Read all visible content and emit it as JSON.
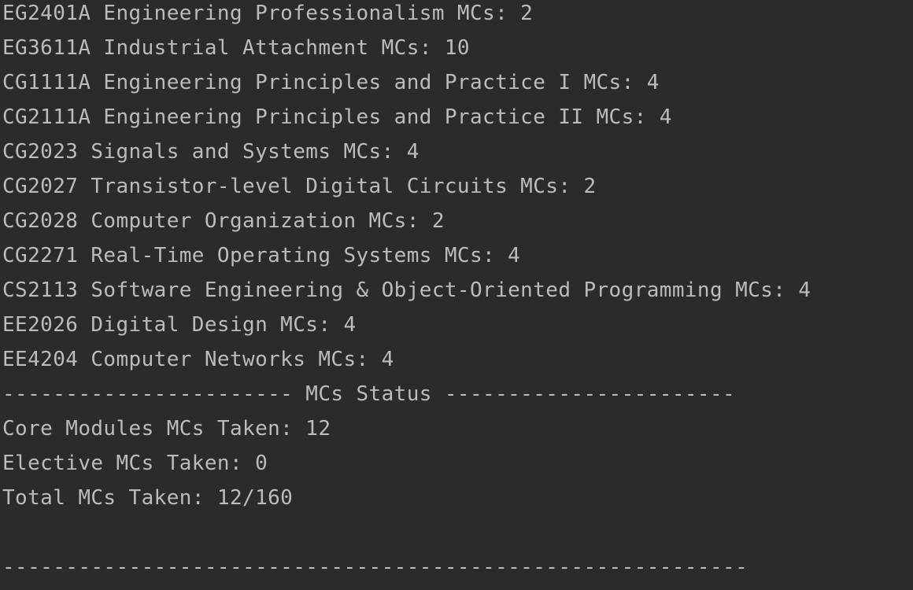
{
  "console": {
    "lines": [
      "EG2401A Engineering Professionalism MCs: 2",
      "EG3611A Industrial Attachment MCs: 10",
      "CG1111A Engineering Principles and Practice I MCs: 4",
      "CG2111A Engineering Principles and Practice II MCs: 4",
      "CG2023 Signals and Systems MCs: 4",
      "CG2027 Transistor-level Digital Circuits MCs: 2",
      "CG2028 Computer Organization MCs: 2",
      "CG2271 Real-Time Operating Systems MCs: 4",
      "CS2113 Software Engineering & Object-Oriented Programming MCs: 4",
      "EE2026 Digital Design MCs: 4",
      "EE4204 Computer Networks MCs: 4",
      "----------------------- MCs Status -----------------------",
      "Core Modules MCs Taken: 12",
      "Elective MCs Taken: 0",
      "Total MCs Taken: 12/160",
      "",
      "-----------------------------------------------------------"
    ]
  }
}
